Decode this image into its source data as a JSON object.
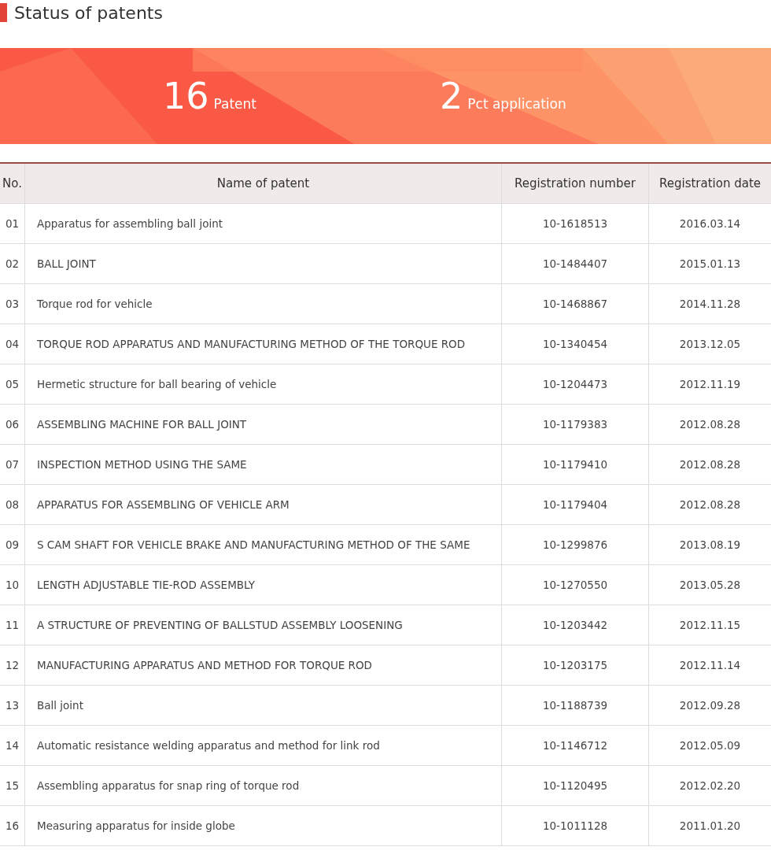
{
  "title": "Status of patents",
  "stats": [
    {
      "value": "16",
      "label": "Patent"
    },
    {
      "value": "2",
      "label": "Pct application"
    }
  ],
  "table": {
    "columns": [
      "No.",
      "Name of patent",
      "Registration number",
      "Registration date"
    ],
    "rows": [
      [
        "01",
        "Apparatus for assembling ball joint",
        "10-1618513",
        "2016.03.14"
      ],
      [
        "02",
        "BALL JOINT",
        "10-1484407",
        "2015.01.13"
      ],
      [
        "03",
        "Torque rod for vehicle",
        "10-1468867",
        "2014.11.28"
      ],
      [
        "04",
        "TORQUE ROD APPARATUS AND MANUFACTURING METHOD OF THE TORQUE ROD",
        "10-1340454",
        "2013.12.05"
      ],
      [
        "05",
        "Hermetic structure for ball bearing of vehicle",
        "10-1204473",
        "2012.11.19"
      ],
      [
        "06",
        "ASSEMBLING MACHINE FOR BALL JOINT",
        "10-1179383",
        "2012.08.28"
      ],
      [
        "07",
        "INSPECTION METHOD USING THE SAME",
        "10-1179410",
        "2012.08.28"
      ],
      [
        "08",
        "APPARATUS FOR ASSEMBLING OF VEHICLE ARM",
        "10-1179404",
        "2012.08.28"
      ],
      [
        "09",
        "S CAM SHAFT FOR VEHICLE BRAKE AND MANUFACTURING METHOD OF THE SAME",
        "10-1299876",
        "2013.08.19"
      ],
      [
        "10",
        "LENGTH ADJUSTABLE TIE-ROD ASSEMBLY",
        "10-1270550",
        "2013.05.28"
      ],
      [
        "11",
        "A STRUCTURE OF PREVENTING OF BALLSTUD ASSEMBLY LOOSENING",
        "10-1203442",
        "2012.11.15"
      ],
      [
        "12",
        "MANUFACTURING APPARATUS AND METHOD FOR TORQUE ROD",
        "10-1203175",
        "2012.11.14"
      ],
      [
        "13",
        "Ball joint",
        "10-1188739",
        "2012.09.28"
      ],
      [
        "14",
        "Automatic resistance welding apparatus and method for link rod",
        "10-1146712",
        "2012.05.09"
      ],
      [
        "15",
        "Assembling apparatus for snap ring of torque rod",
        "10-1120495",
        "2012.02.20"
      ],
      [
        "16",
        "Measuring apparatus for inside globe",
        "10-1011128",
        "2011.01.20"
      ]
    ]
  }
}
